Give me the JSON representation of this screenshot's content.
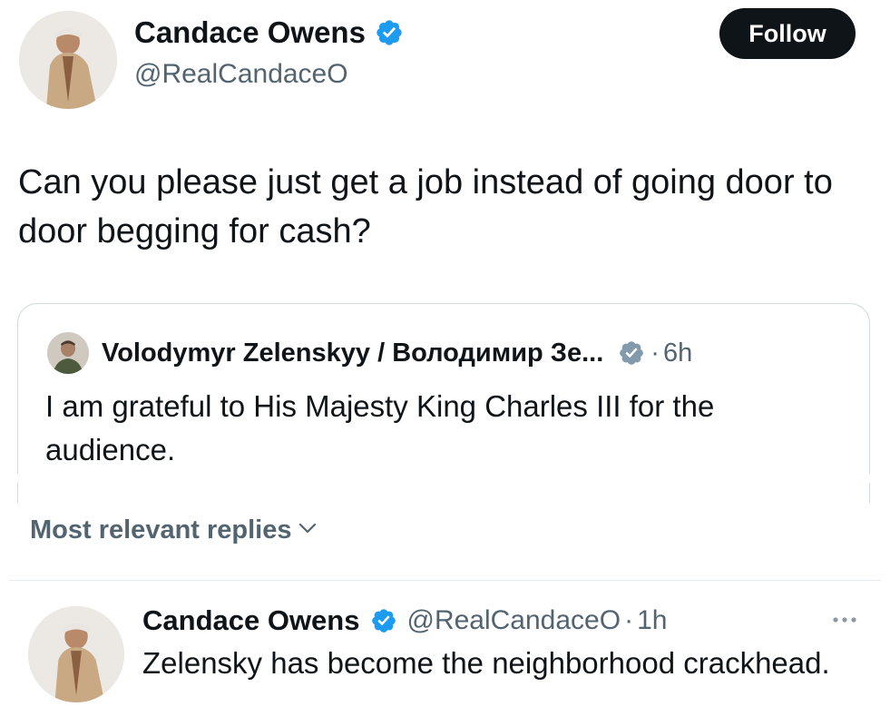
{
  "main_tweet": {
    "author_name": "Candace Owens",
    "author_handle": "@RealCandaceO",
    "follow_label": "Follow",
    "text": "Can you please just get a job instead of going door to door begging for cash?",
    "verified_icon": "verified-badge-icon",
    "avatar_icon": "profile-photo"
  },
  "quoted_tweet": {
    "author_name": "Volodymyr Zelenskyy / Володимир Зе...",
    "separator": "·",
    "time": "6h",
    "text": "I am grateful to His Majesty King Charles III for the audience.",
    "verified_icon": "verified-badge-grey-icon"
  },
  "replies_section": {
    "sort_label": "Most relevant replies",
    "sort_icon": "chevron-down-icon"
  },
  "reply": {
    "author_name": "Candace Owens",
    "author_handle": "@RealCandaceO",
    "separator": "·",
    "time": "1h",
    "text": "Zelensky has become the neighborhood crackhead.",
    "more_icon": "more-options-icon"
  },
  "colors": {
    "text_primary": "#0f1419",
    "text_secondary": "#536471",
    "verified_blue": "#1d9bf0",
    "verified_grey": "#829aab",
    "follow_bg": "#0f1419",
    "border": "#cfd9de"
  }
}
